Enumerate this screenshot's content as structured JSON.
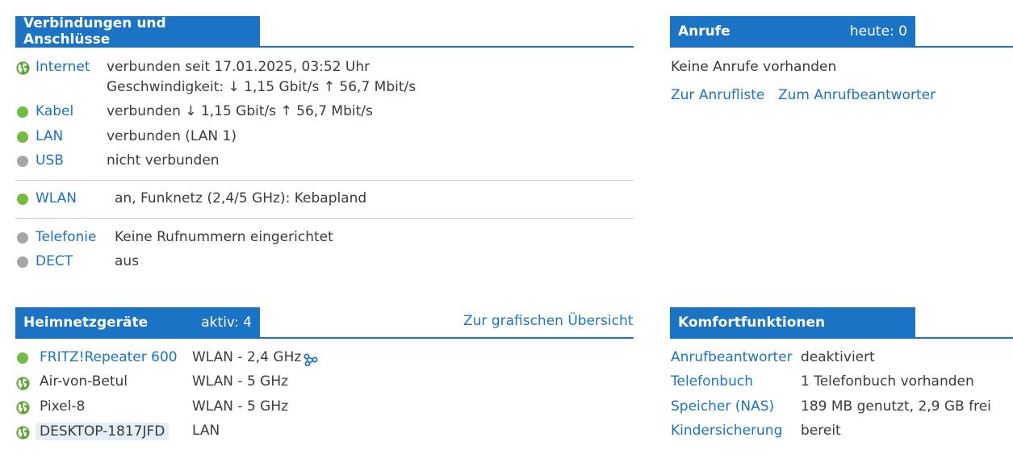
{
  "connections": {
    "title": "Verbindungen und Anschlüsse",
    "internet": {
      "label": "Internet",
      "status": "verbunden seit 17.01.2025, 03:52 Uhr",
      "speed": "Geschwindigkeit: ↓ 1,15 Gbit/s ↑ 56,7 Mbit/s"
    },
    "cable": {
      "label": "Kabel",
      "status": "verbunden ↓ 1,15 Gbit/s ↑ 56,7 Mbit/s"
    },
    "lan": {
      "label": "LAN",
      "status": "verbunden (LAN 1)"
    },
    "usb": {
      "label": "USB",
      "status": "nicht verbunden"
    },
    "wlan": {
      "label": "WLAN",
      "status": "an, Funknetz (2,4/5 GHz): Kebapland"
    },
    "telephony": {
      "label": "Telefonie",
      "status": "Keine Rufnummern eingerichtet"
    },
    "dect": {
      "label": "DECT",
      "status": "aus"
    }
  },
  "calls": {
    "title": "Anrufe",
    "count": "heute: 0",
    "empty_text": "Keine Anrufe vorhanden",
    "link_calllist": "Zur Anrufliste",
    "link_answering": "Zum Anrufbeantworter"
  },
  "homenet": {
    "title": "Heimnetzgeräte",
    "count": "aktiv: 4",
    "overview_link": "Zur grafischen Übersicht",
    "devices": [
      {
        "name": "FRITZ!Repeater 600",
        "conn": "WLAN - 2,4 GHz"
      },
      {
        "name": "Air-von-Betul",
        "conn": "WLAN - 5 GHz"
      },
      {
        "name": "Pixel-8",
        "conn": "WLAN - 5 GHz"
      },
      {
        "name": "DESKTOP-1817JFD",
        "conn": "LAN"
      }
    ]
  },
  "comfort": {
    "title": "Komfortfunktionen",
    "items": [
      {
        "label": "Anrufbeantworter",
        "value": "deaktiviert"
      },
      {
        "label": "Telefonbuch",
        "value": "1 Telefonbuch vorhanden"
      },
      {
        "label": "Speicher (NAS)",
        "value": "189 MB genutzt, 2,9 GB frei"
      },
      {
        "label": "Kindersicherung",
        "value": "bereit"
      }
    ]
  },
  "colors": {
    "accent": "#1b73c5",
    "status_green": "#72bd3f",
    "status_gray": "#a6a6a6"
  }
}
